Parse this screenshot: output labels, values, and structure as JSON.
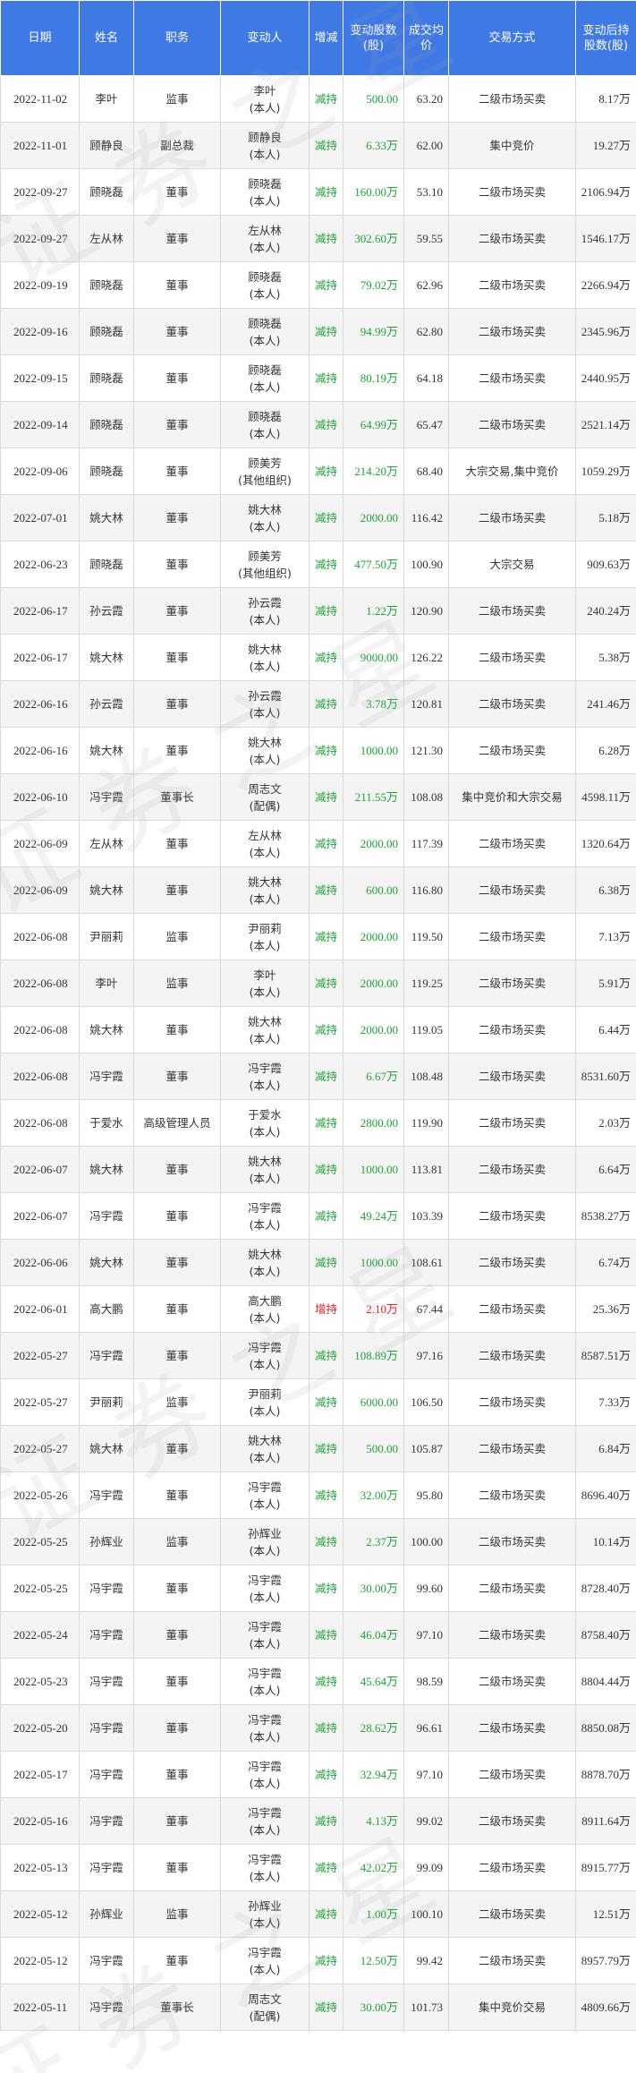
{
  "table": {
    "headers": {
      "date": "日期",
      "name": "姓名",
      "role": "职务",
      "person_line1": "变动人",
      "direction": "增减",
      "shares": "变动股数(股)",
      "price": "成交均价",
      "method": "交易方式",
      "after": "变动后持股数(股)"
    },
    "rows": [
      {
        "date": "2022-11-02",
        "name": "李叶",
        "role": "监事",
        "person_line1": "李叶",
        "person_line2": "(本人)",
        "direction": "减持",
        "shares": "500.00",
        "price": "63.20",
        "method": "二级市场买卖",
        "after": "8.17万"
      },
      {
        "date": "2022-11-01",
        "name": "顾静良",
        "role": "副总裁",
        "person_line1": "顾静良",
        "person_line2": "(本人)",
        "direction": "减持",
        "shares": "6.33万",
        "price": "62.00",
        "method": "集中竞价",
        "after": "19.27万"
      },
      {
        "date": "2022-09-27",
        "name": "顾晓磊",
        "role": "董事",
        "person_line1": "顾晓磊",
        "person_line2": "(本人)",
        "direction": "减持",
        "shares": "160.00万",
        "price": "53.10",
        "method": "二级市场买卖",
        "after": "2106.94万"
      },
      {
        "date": "2022-09-27",
        "name": "左从林",
        "role": "董事",
        "person_line1": "左从林",
        "person_line2": "(本人)",
        "direction": "减持",
        "shares": "302.60万",
        "price": "59.55",
        "method": "二级市场买卖",
        "after": "1546.17万"
      },
      {
        "date": "2022-09-19",
        "name": "顾晓磊",
        "role": "董事",
        "person_line1": "顾晓磊",
        "person_line2": "(本人)",
        "direction": "减持",
        "shares": "79.02万",
        "price": "62.96",
        "method": "二级市场买卖",
        "after": "2266.94万"
      },
      {
        "date": "2022-09-16",
        "name": "顾晓磊",
        "role": "董事",
        "person_line1": "顾晓磊",
        "person_line2": "(本人)",
        "direction": "减持",
        "shares": "94.99万",
        "price": "62.80",
        "method": "二级市场买卖",
        "after": "2345.96万"
      },
      {
        "date": "2022-09-15",
        "name": "顾晓磊",
        "role": "董事",
        "person_line1": "顾晓磊",
        "person_line2": "(本人)",
        "direction": "减持",
        "shares": "80.19万",
        "price": "64.18",
        "method": "二级市场买卖",
        "after": "2440.95万"
      },
      {
        "date": "2022-09-14",
        "name": "顾晓磊",
        "role": "董事",
        "person_line1": "顾晓磊",
        "person_line2": "(本人)",
        "direction": "减持",
        "shares": "64.99万",
        "price": "65.47",
        "method": "二级市场买卖",
        "after": "2521.14万"
      },
      {
        "date": "2022-09-06",
        "name": "顾晓磊",
        "role": "董事",
        "person_line1": "顾美芳",
        "person_line2": "(其他组织)",
        "direction": "减持",
        "shares": "214.20万",
        "price": "68.40",
        "method": "大宗交易,集中竞价",
        "after": "1059.29万"
      },
      {
        "date": "2022-07-01",
        "name": "姚大林",
        "role": "董事",
        "person_line1": "姚大林",
        "person_line2": "(本人)",
        "direction": "减持",
        "shares": "2000.00",
        "price": "116.42",
        "method": "二级市场买卖",
        "after": "5.18万"
      },
      {
        "date": "2022-06-23",
        "name": "顾晓磊",
        "role": "董事",
        "person_line1": "顾美芳",
        "person_line2": "(其他组织)",
        "direction": "减持",
        "shares": "477.50万",
        "price": "100.90",
        "method": "大宗交易",
        "after": "909.63万"
      },
      {
        "date": "2022-06-17",
        "name": "孙云霞",
        "role": "董事",
        "person_line1": "孙云霞",
        "person_line2": "(本人)",
        "direction": "减持",
        "shares": "1.22万",
        "price": "120.90",
        "method": "二级市场买卖",
        "after": "240.24万"
      },
      {
        "date": "2022-06-17",
        "name": "姚大林",
        "role": "董事",
        "person_line1": "姚大林",
        "person_line2": "(本人)",
        "direction": "减持",
        "shares": "9000.00",
        "price": "126.22",
        "method": "二级市场买卖",
        "after": "5.38万"
      },
      {
        "date": "2022-06-16",
        "name": "孙云霞",
        "role": "董事",
        "person_line1": "孙云霞",
        "person_line2": "(本人)",
        "direction": "减持",
        "shares": "3.78万",
        "price": "120.81",
        "method": "二级市场买卖",
        "after": "241.46万"
      },
      {
        "date": "2022-06-16",
        "name": "姚大林",
        "role": "董事",
        "person_line1": "姚大林",
        "person_line2": "(本人)",
        "direction": "减持",
        "shares": "1000.00",
        "price": "121.30",
        "method": "二级市场买卖",
        "after": "6.28万"
      },
      {
        "date": "2022-06-10",
        "name": "冯宇霞",
        "role": "董事长",
        "person_line1": "周志文",
        "person_line2": "(配偶)",
        "direction": "减持",
        "shares": "211.55万",
        "price": "108.08",
        "method": "集中竞价和大宗交易",
        "after": "4598.11万"
      },
      {
        "date": "2022-06-09",
        "name": "左从林",
        "role": "董事",
        "person_line1": "左从林",
        "person_line2": "(本人)",
        "direction": "减持",
        "shares": "2000.00",
        "price": "117.39",
        "method": "二级市场买卖",
        "after": "1320.64万"
      },
      {
        "date": "2022-06-09",
        "name": "姚大林",
        "role": "董事",
        "person_line1": "姚大林",
        "person_line2": "(本人)",
        "direction": "减持",
        "shares": "600.00",
        "price": "116.80",
        "method": "二级市场买卖",
        "after": "6.38万"
      },
      {
        "date": "2022-06-08",
        "name": "尹丽莉",
        "role": "监事",
        "person_line1": "尹丽莉",
        "person_line2": "(本人)",
        "direction": "减持",
        "shares": "2000.00",
        "price": "119.50",
        "method": "二级市场买卖",
        "after": "7.13万"
      },
      {
        "date": "2022-06-08",
        "name": "李叶",
        "role": "监事",
        "person_line1": "李叶",
        "person_line2": "(本人)",
        "direction": "减持",
        "shares": "2000.00",
        "price": "119.25",
        "method": "二级市场买卖",
        "after": "5.91万"
      },
      {
        "date": "2022-06-08",
        "name": "姚大林",
        "role": "董事",
        "person_line1": "姚大林",
        "person_line2": "(本人)",
        "direction": "减持",
        "shares": "2000.00",
        "price": "119.05",
        "method": "二级市场买卖",
        "after": "6.44万"
      },
      {
        "date": "2022-06-08",
        "name": "冯宇霞",
        "role": "董事",
        "person_line1": "冯宇霞",
        "person_line2": "(本人)",
        "direction": "减持",
        "shares": "6.67万",
        "price": "108.48",
        "method": "二级市场买卖",
        "after": "8531.60万"
      },
      {
        "date": "2022-06-08",
        "name": "于爱水",
        "role": "高级管理人员",
        "person_line1": "于爱水",
        "person_line2": "(本人)",
        "direction": "减持",
        "shares": "2800.00",
        "price": "119.90",
        "method": "二级市场买卖",
        "after": "2.03万"
      },
      {
        "date": "2022-06-07",
        "name": "姚大林",
        "role": "董事",
        "person_line1": "姚大林",
        "person_line2": "(本人)",
        "direction": "减持",
        "shares": "1000.00",
        "price": "113.81",
        "method": "二级市场买卖",
        "after": "6.64万"
      },
      {
        "date": "2022-06-07",
        "name": "冯宇霞",
        "role": "董事",
        "person_line1": "冯宇霞",
        "person_line2": "(本人)",
        "direction": "减持",
        "shares": "49.24万",
        "price": "103.39",
        "method": "二级市场买卖",
        "after": "8538.27万"
      },
      {
        "date": "2022-06-06",
        "name": "姚大林",
        "role": "董事",
        "person_line1": "姚大林",
        "person_line2": "(本人)",
        "direction": "减持",
        "shares": "1000.00",
        "price": "108.61",
        "method": "二级市场买卖",
        "after": "6.74万"
      },
      {
        "date": "2022-06-01",
        "name": "高大鹏",
        "role": "董事",
        "person_line1": "高大鹏",
        "person_line2": "(本人)",
        "direction": "增持",
        "shares": "2.10万",
        "price": "67.44",
        "method": "二级市场买卖",
        "after": "25.36万"
      },
      {
        "date": "2022-05-27",
        "name": "冯宇霞",
        "role": "董事",
        "person_line1": "冯宇霞",
        "person_line2": "(本人)",
        "direction": "减持",
        "shares": "108.89万",
        "price": "97.16",
        "method": "二级市场买卖",
        "after": "8587.51万"
      },
      {
        "date": "2022-05-27",
        "name": "尹丽莉",
        "role": "监事",
        "person_line1": "尹丽莉",
        "person_line2": "(本人)",
        "direction": "减持",
        "shares": "6000.00",
        "price": "106.50",
        "method": "二级市场买卖",
        "after": "7.33万"
      },
      {
        "date": "2022-05-27",
        "name": "姚大林",
        "role": "董事",
        "person_line1": "姚大林",
        "person_line2": "(本人)",
        "direction": "减持",
        "shares": "500.00",
        "price": "105.87",
        "method": "二级市场买卖",
        "after": "6.84万"
      },
      {
        "date": "2022-05-26",
        "name": "冯宇霞",
        "role": "董事",
        "person_line1": "冯宇霞",
        "person_line2": "(本人)",
        "direction": "减持",
        "shares": "32.00万",
        "price": "95.80",
        "method": "二级市场买卖",
        "after": "8696.40万"
      },
      {
        "date": "2022-05-25",
        "name": "孙辉业",
        "role": "监事",
        "person_line1": "孙辉业",
        "person_line2": "(本人)",
        "direction": "减持",
        "shares": "2.37万",
        "price": "100.00",
        "method": "二级市场买卖",
        "after": "10.14万"
      },
      {
        "date": "2022-05-25",
        "name": "冯宇霞",
        "role": "董事",
        "person_line1": "冯宇霞",
        "person_line2": "(本人)",
        "direction": "减持",
        "shares": "30.00万",
        "price": "99.60",
        "method": "二级市场买卖",
        "after": "8728.40万"
      },
      {
        "date": "2022-05-24",
        "name": "冯宇霞",
        "role": "董事",
        "person_line1": "冯宇霞",
        "person_line2": "(本人)",
        "direction": "减持",
        "shares": "46.04万",
        "price": "97.10",
        "method": "二级市场买卖",
        "after": "8758.40万"
      },
      {
        "date": "2022-05-23",
        "name": "冯宇霞",
        "role": "董事",
        "person_line1": "冯宇霞",
        "person_line2": "(本人)",
        "direction": "减持",
        "shares": "45.64万",
        "price": "98.59",
        "method": "二级市场买卖",
        "after": "8804.44万"
      },
      {
        "date": "2022-05-20",
        "name": "冯宇霞",
        "role": "董事",
        "person_line1": "冯宇霞",
        "person_line2": "(本人)",
        "direction": "减持",
        "shares": "28.62万",
        "price": "96.61",
        "method": "二级市场买卖",
        "after": "8850.08万"
      },
      {
        "date": "2022-05-17",
        "name": "冯宇霞",
        "role": "董事",
        "person_line1": "冯宇霞",
        "person_line2": "(本人)",
        "direction": "减持",
        "shares": "32.94万",
        "price": "97.10",
        "method": "二级市场买卖",
        "after": "8878.70万"
      },
      {
        "date": "2022-05-16",
        "name": "冯宇霞",
        "role": "董事",
        "person_line1": "冯宇霞",
        "person_line2": "(本人)",
        "direction": "减持",
        "shares": "4.13万",
        "price": "99.02",
        "method": "二级市场买卖",
        "after": "8911.64万"
      },
      {
        "date": "2022-05-13",
        "name": "冯宇霞",
        "role": "董事",
        "person_line1": "冯宇霞",
        "person_line2": "(本人)",
        "direction": "减持",
        "shares": "42.02万",
        "price": "99.09",
        "method": "二级市场买卖",
        "after": "8915.77万"
      },
      {
        "date": "2022-05-12",
        "name": "孙辉业",
        "role": "监事",
        "person_line1": "孙辉业",
        "person_line2": "(本人)",
        "direction": "减持",
        "shares": "1.00万",
        "price": "100.10",
        "method": "二级市场买卖",
        "after": "12.51万"
      },
      {
        "date": "2022-05-12",
        "name": "冯宇霞",
        "role": "董事",
        "person_line1": "冯宇霞",
        "person_line2": "(本人)",
        "direction": "减持",
        "shares": "12.50万",
        "price": "99.42",
        "method": "二级市场买卖",
        "after": "8957.79万"
      },
      {
        "date": "2022-05-11",
        "name": "冯宇霞",
        "role": "董事长",
        "person_line1": "周志文",
        "person_line2": "(配偶)",
        "direction": "减持",
        "shares": "30.00万",
        "price": "101.73",
        "method": "集中竞价交易",
        "after": "4809.66万"
      }
    ]
  },
  "colors": {
    "header_bg": "#3e79e6",
    "decrease": "#1aa632",
    "increase": "#e5211c"
  }
}
